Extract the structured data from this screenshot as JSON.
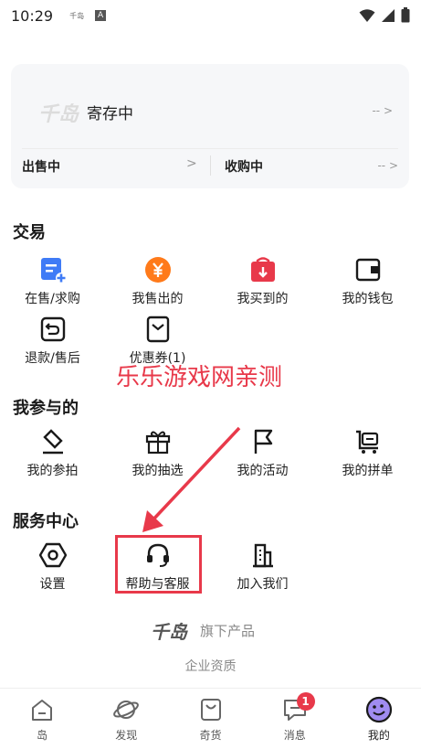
{
  "status": {
    "time": "10:29",
    "mini": "千岛",
    "a": "A"
  },
  "card": {
    "logo": "千岛",
    "title": "寄存中",
    "more": "-- >",
    "sell": "出售中",
    "sell_arrow": ">",
    "buy": "收购中",
    "buy_more": "-- >"
  },
  "sections": {
    "trade": "交易",
    "participate": "我参与的",
    "service": "服务中心"
  },
  "trade_items": [
    "在售/求购",
    "我售出的",
    "我买到的",
    "我的钱包",
    "退款/售后",
    "优惠券(1)"
  ],
  "participate_items": [
    "我的参拍",
    "我的抽选",
    "我的活动",
    "我的拼单"
  ],
  "service_items": [
    "设置",
    "帮助与客服",
    "加入我们"
  ],
  "watermark": "乐乐游戏网亲测",
  "brand": {
    "logo": "千岛",
    "text": "旗下产品"
  },
  "qualification": "企业资质",
  "tabs": [
    "岛",
    "发现",
    "奇货",
    "消息",
    "我的"
  ],
  "message_badge": "1",
  "colors": {
    "accent_red": "#e8394a",
    "orange": "#ff7a1a",
    "blue": "#3f7bf6"
  }
}
